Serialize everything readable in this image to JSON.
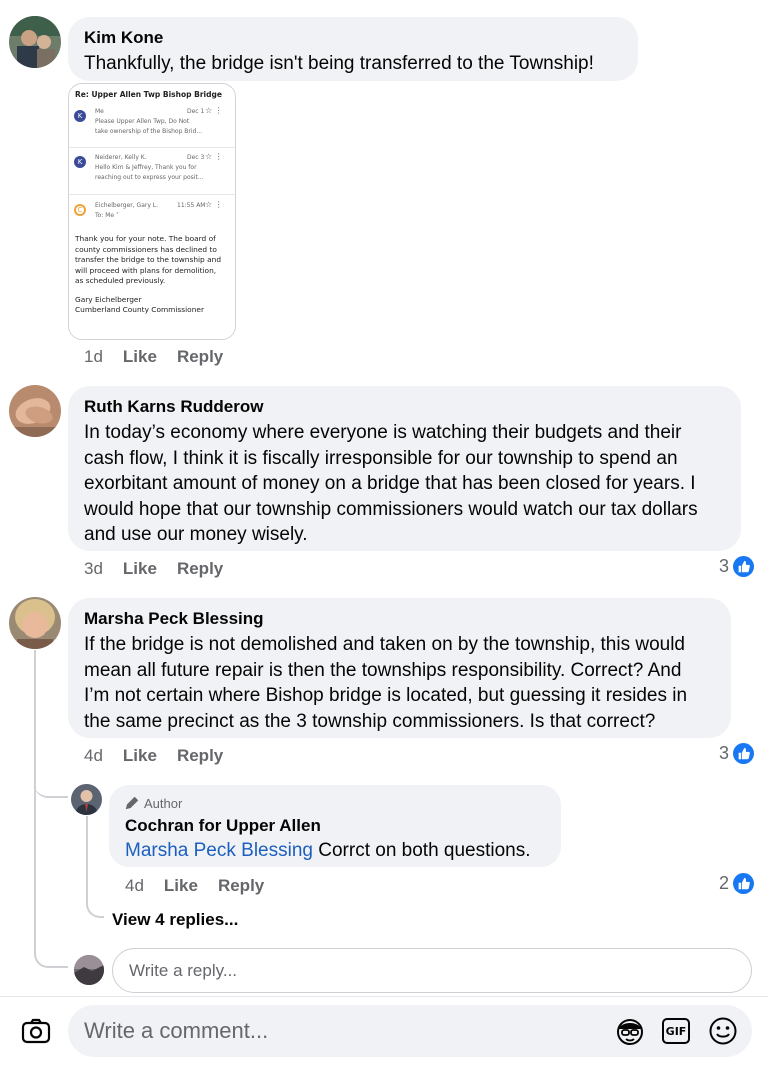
{
  "comments": [
    {
      "author": "Kim Kone",
      "text": "Thankfully, the bridge isn't being transferred to the Township!",
      "time": "1d",
      "like_label": "Like",
      "reply_label": "Reply",
      "email": {
        "subject": "Re: Upper Allen Twp Bishop Bridge",
        "messages": [
          {
            "from": "Me",
            "date": "Dec 1",
            "avatar_letter": "K",
            "avatar_color": "#3b4b9a",
            "lines": [
              "Please Upper Allen Twp, Do Not",
              "take ownership of the Bishop Brid..."
            ]
          },
          {
            "from": "Neiderer, Kelly K.",
            "date": "Dec 3",
            "avatar_letter": "K",
            "avatar_color": "#3b4b9a",
            "lines": [
              "Hello Kim & Jeffrey, Thank you for",
              "reaching out to express your posit..."
            ]
          },
          {
            "from": "Eichelberger, Gary L.",
            "date": "11:55 AM",
            "avatar_letter": "C",
            "avatar_color": "#f0a23b",
            "lines": [
              "To: Me ˅"
            ]
          }
        ],
        "body": [
          "Thank you for your note. The board of",
          "county commissioners has declined to",
          "transfer the bridge to the township and",
          "will proceed with plans for demolition,",
          "as scheduled previously.",
          "",
          "Gary Eichelberger",
          "Cumberland County Commissioner"
        ]
      }
    },
    {
      "author": "Ruth Karns Rudderow",
      "lines": [
        "In today’s economy where everyone is watching their budgets and their",
        "cash flow, I think it is fiscally irresponsible for our township to spend an",
        "exorbitant amount of money on a bridge that has been closed for years. I",
        "would hope that our township commissioners would watch our tax dollars",
        "and use our money wisely."
      ],
      "time": "3d",
      "like_label": "Like",
      "reply_label": "Reply",
      "reactions": "3"
    },
    {
      "author": "Marsha Peck Blessing",
      "lines": [
        "If the bridge is not demolished and taken on by the township, this would",
        "mean all future repair is then the townships responsibility. Correct? And",
        "I’m not certain where Bishop bridge is located, but guessing it resides in",
        "the same precinct as the 3 township commissioners. Is that correct?"
      ],
      "time": "4d",
      "like_label": "Like",
      "reply_label": "Reply",
      "reactions": "3",
      "reply": {
        "badge": "Author",
        "author": "Cochran for Upper Allen",
        "mention": "Marsha Peck Blessing",
        "text": " Corrct on both questions.",
        "time": "4d",
        "like_label": "Like",
        "reply_label": "Reply",
        "reactions": "2"
      },
      "view_replies": "View 4 replies..."
    }
  ],
  "reply_placeholder": "Write a reply...",
  "comment_placeholder": "Write a comment...",
  "gif_label": "GIF",
  "colors": {
    "accent": "#1877f2",
    "bubble": "#f0f2f5",
    "secondary_text": "#65676b"
  }
}
